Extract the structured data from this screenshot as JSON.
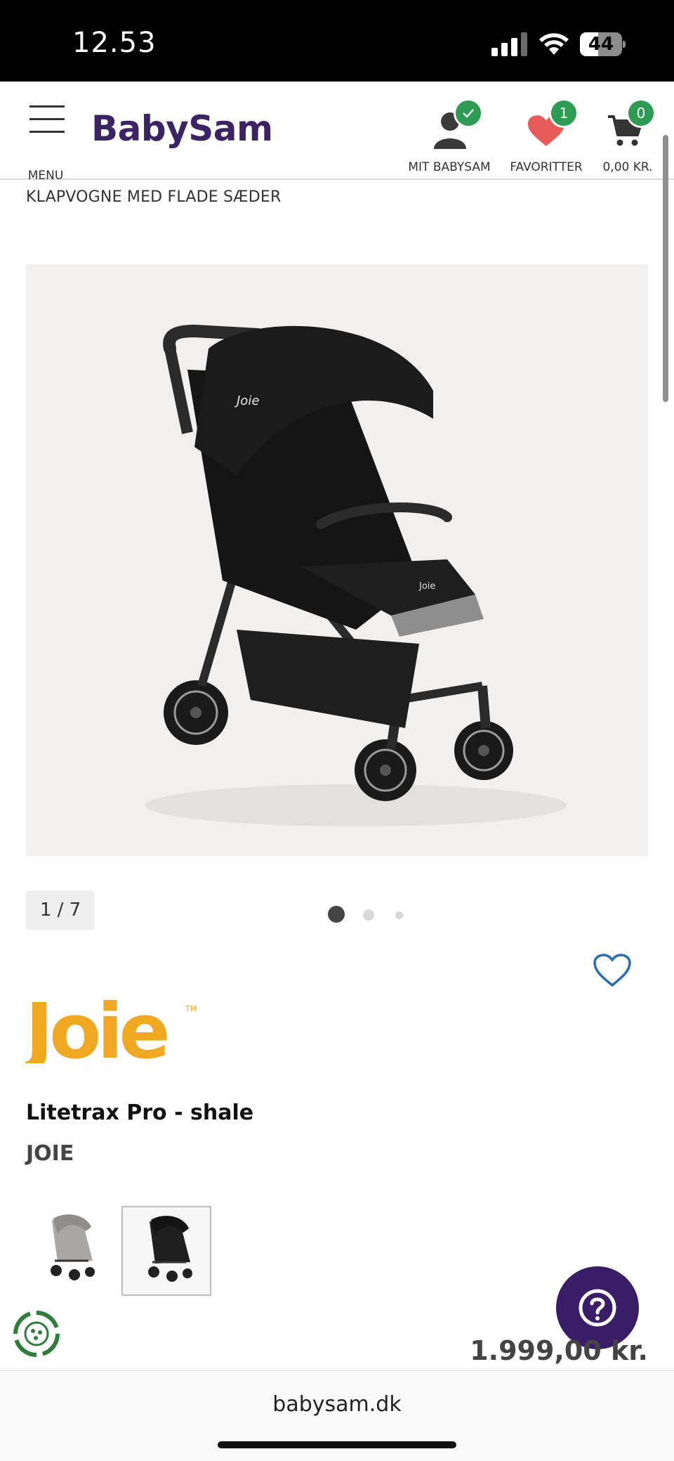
{
  "status_bar": {
    "time": "12.53",
    "battery": "44",
    "battery_level": 0.44
  },
  "header": {
    "menu_label": "MENU",
    "logo": "BabySam",
    "account_label": "MIT BABYSAM",
    "favorites_label": "FAVORITTER",
    "favorites_count": "1",
    "cart_label": "0,00 KR.",
    "cart_count": "0"
  },
  "breadcrumb": "KLAPVOGNE MED FLADE SÆDER",
  "gallery": {
    "counter": "1 / 7",
    "current_index": 1,
    "total": 7
  },
  "product": {
    "brand_logo_text": "Joie",
    "name": "Litetrax Pro - shale",
    "brand": "JOIE",
    "price": "1.999,00 kr.",
    "variants": [
      {
        "name": "grey variant",
        "selected": false
      },
      {
        "name": "black variant",
        "selected": true
      }
    ]
  },
  "browser": {
    "url": "babysam.dk"
  },
  "colors": {
    "brand_purple": "#3a1d67",
    "badge_green": "#2d9b52",
    "heart_red": "#e85b5b",
    "favorite_blue": "#2a6db5",
    "joie_orange": "#f0a823"
  },
  "icons": {
    "menu": "hamburger-icon",
    "account": "person-icon",
    "favorites": "heart-icon",
    "cart": "cart-icon",
    "help": "question-icon",
    "eco": "recycle-icon"
  }
}
